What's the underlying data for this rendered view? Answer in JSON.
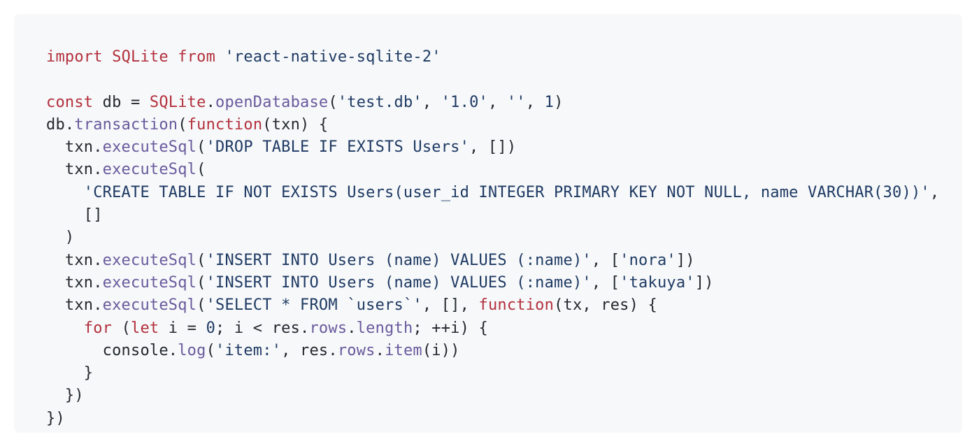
{
  "colors": {
    "background": "#ffffff",
    "code_background": "#f6f8fa",
    "plain": "#24292e",
    "keyword": "#b3303c",
    "function": "#6a5a9c",
    "string": "#1f3a63"
  },
  "code": {
    "language": "javascript",
    "lines": [
      [
        {
          "t": "kw",
          "v": "import "
        },
        {
          "t": "id",
          "v": "SQLite "
        },
        {
          "t": "kw",
          "v": "from "
        },
        {
          "t": "str",
          "v": "'react-native-sqlite-2'"
        }
      ],
      [],
      [
        {
          "t": "kw",
          "v": "const "
        },
        {
          "t": "plain",
          "v": "db = "
        },
        {
          "t": "id",
          "v": "SQLite"
        },
        {
          "t": "plain",
          "v": "."
        },
        {
          "t": "fn",
          "v": "openDatabase"
        },
        {
          "t": "plain",
          "v": "("
        },
        {
          "t": "str",
          "v": "'test.db'"
        },
        {
          "t": "plain",
          "v": ", "
        },
        {
          "t": "str",
          "v": "'1.0'"
        },
        {
          "t": "plain",
          "v": ", "
        },
        {
          "t": "str",
          "v": "''"
        },
        {
          "t": "plain",
          "v": ", "
        },
        {
          "t": "num",
          "v": "1"
        },
        {
          "t": "plain",
          "v": ")"
        }
      ],
      [
        {
          "t": "plain",
          "v": "db."
        },
        {
          "t": "fn",
          "v": "transaction"
        },
        {
          "t": "plain",
          "v": "("
        },
        {
          "t": "kw",
          "v": "function"
        },
        {
          "t": "plain",
          "v": "(txn) {"
        }
      ],
      [
        {
          "t": "plain",
          "v": "  txn."
        },
        {
          "t": "fn",
          "v": "executeSql"
        },
        {
          "t": "plain",
          "v": "("
        },
        {
          "t": "str",
          "v": "'DROP TABLE IF EXISTS Users'"
        },
        {
          "t": "plain",
          "v": ", [])"
        }
      ],
      [
        {
          "t": "plain",
          "v": "  txn."
        },
        {
          "t": "fn",
          "v": "executeSql"
        },
        {
          "t": "plain",
          "v": "("
        }
      ],
      [
        {
          "t": "plain",
          "v": "    "
        },
        {
          "t": "str",
          "v": "'CREATE TABLE IF NOT EXISTS Users(user_id INTEGER PRIMARY KEY NOT NULL, name VARCHAR(30))'"
        },
        {
          "t": "plain",
          "v": ","
        }
      ],
      [
        {
          "t": "plain",
          "v": "    []"
        }
      ],
      [
        {
          "t": "plain",
          "v": "  )"
        }
      ],
      [
        {
          "t": "plain",
          "v": "  txn."
        },
        {
          "t": "fn",
          "v": "executeSql"
        },
        {
          "t": "plain",
          "v": "("
        },
        {
          "t": "str",
          "v": "'INSERT INTO Users (name) VALUES (:name)'"
        },
        {
          "t": "plain",
          "v": ", ["
        },
        {
          "t": "str",
          "v": "'nora'"
        },
        {
          "t": "plain",
          "v": "])"
        }
      ],
      [
        {
          "t": "plain",
          "v": "  txn."
        },
        {
          "t": "fn",
          "v": "executeSql"
        },
        {
          "t": "plain",
          "v": "("
        },
        {
          "t": "str",
          "v": "'INSERT INTO Users (name) VALUES (:name)'"
        },
        {
          "t": "plain",
          "v": ", ["
        },
        {
          "t": "str",
          "v": "'takuya'"
        },
        {
          "t": "plain",
          "v": "])"
        }
      ],
      [
        {
          "t": "plain",
          "v": "  txn."
        },
        {
          "t": "fn",
          "v": "executeSql"
        },
        {
          "t": "plain",
          "v": "("
        },
        {
          "t": "str",
          "v": "'SELECT * FROM `users`'"
        },
        {
          "t": "plain",
          "v": ", [], "
        },
        {
          "t": "kw",
          "v": "function"
        },
        {
          "t": "plain",
          "v": "(tx, res) {"
        }
      ],
      [
        {
          "t": "plain",
          "v": "    "
        },
        {
          "t": "kw",
          "v": "for "
        },
        {
          "t": "plain",
          "v": "("
        },
        {
          "t": "kw",
          "v": "let "
        },
        {
          "t": "plain",
          "v": "i = "
        },
        {
          "t": "num",
          "v": "0"
        },
        {
          "t": "plain",
          "v": "; i < res."
        },
        {
          "t": "fn",
          "v": "rows"
        },
        {
          "t": "plain",
          "v": "."
        },
        {
          "t": "fn",
          "v": "length"
        },
        {
          "t": "plain",
          "v": "; ++i) {"
        }
      ],
      [
        {
          "t": "plain",
          "v": "      console."
        },
        {
          "t": "fn",
          "v": "log"
        },
        {
          "t": "plain",
          "v": "("
        },
        {
          "t": "str",
          "v": "'item:'"
        },
        {
          "t": "plain",
          "v": ", res."
        },
        {
          "t": "fn",
          "v": "rows"
        },
        {
          "t": "plain",
          "v": "."
        },
        {
          "t": "fn",
          "v": "item"
        },
        {
          "t": "plain",
          "v": "(i))"
        }
      ],
      [
        {
          "t": "plain",
          "v": "    }"
        }
      ],
      [
        {
          "t": "plain",
          "v": "  })"
        }
      ],
      [
        {
          "t": "plain",
          "v": "})"
        }
      ]
    ]
  }
}
